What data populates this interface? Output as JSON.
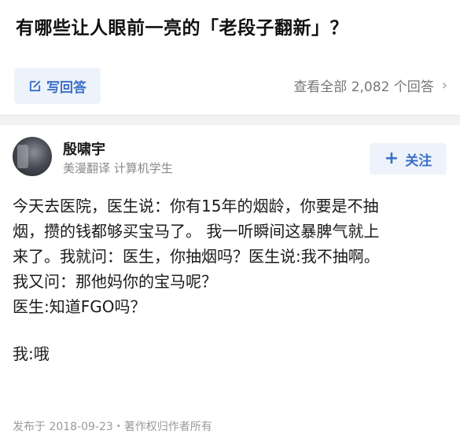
{
  "question": {
    "title": "有哪些让人眼前一亮的「老段子翻新」？"
  },
  "actions": {
    "write_answer_label": "写回答",
    "view_all_label": "查看全部 2,082 个回答",
    "chevron": "›"
  },
  "author": {
    "name": "殷啸宇",
    "bio": "美漫翻译 计算机学生",
    "follow_label": "关注",
    "follow_plus": "+"
  },
  "answer": {
    "lines": [
      "今天去医院，医生说：你有15年的烟龄，你要是不抽",
      "烟，攒的钱都够买宝马了。 我一听瞬间这暴脾气就上",
      "来了。我就问：医生，你抽烟吗？医生说:我不抽啊。",
      "我又问：那他妈你的宝马呢？",
      "医生:知道FGO吗？",
      "我:哦"
    ],
    "footer": "发布于 2018-09-23・著作权归作者所有"
  },
  "colors": {
    "accent": "#3b6fc7",
    "accent_bg": "#eef3fb",
    "muted": "#8a8a8a"
  },
  "icons": {
    "write": "pencil-edit-icon",
    "chevron": "chevron-right-icon",
    "plus": "plus-icon"
  }
}
